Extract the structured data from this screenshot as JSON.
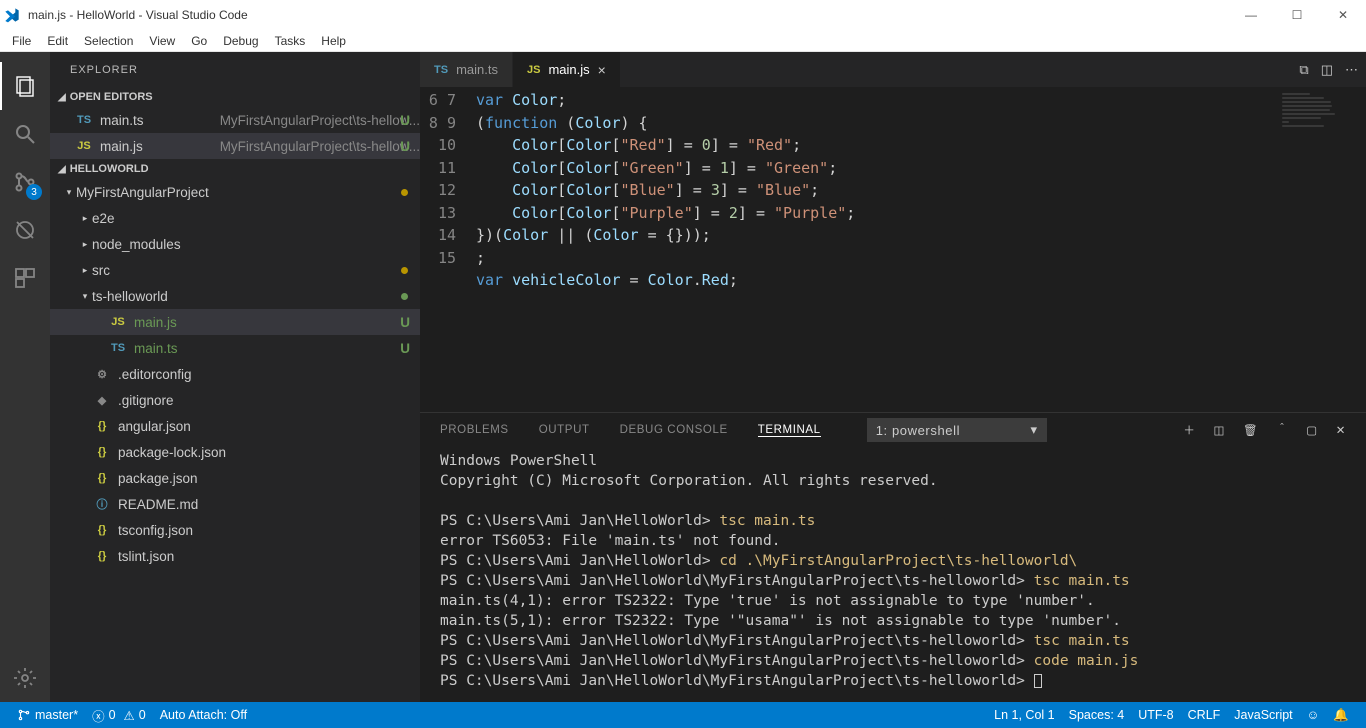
{
  "window": {
    "title": "main.js - HelloWorld - Visual Studio Code"
  },
  "menu": [
    "File",
    "Edit",
    "Selection",
    "View",
    "Go",
    "Debug",
    "Tasks",
    "Help"
  ],
  "activitybar_badge": "3",
  "sidebar": {
    "title": "EXPLORER",
    "open_editors_label": "OPEN EDITORS",
    "open_editors": [
      {
        "icon": "TS",
        "iconClass": "ts",
        "name": "main.ts",
        "meta": "MyFirstAngularProject\\ts-hellow...",
        "badge": "U"
      },
      {
        "icon": "JS",
        "iconClass": "js",
        "name": "main.js",
        "meta": "MyFirstAngularProject\\ts-hellow...",
        "badge": "U",
        "active": true
      }
    ],
    "repo_label": "HELLOWORLD",
    "tree": [
      {
        "indent": 0,
        "chev": "▾",
        "name": "MyFirstAngularProject",
        "dot": "#b89500"
      },
      {
        "indent": 1,
        "chev": "▸",
        "name": "e2e"
      },
      {
        "indent": 1,
        "chev": "▸",
        "name": "node_modules"
      },
      {
        "indent": 1,
        "chev": "▸",
        "name": "src",
        "dot": "#b89500"
      },
      {
        "indent": 1,
        "chev": "▾",
        "name": "ts-helloworld",
        "dot": "#6a9955"
      },
      {
        "indent": 2,
        "icon": "JS",
        "iconClass": "js",
        "name": "main.js",
        "badge": "U",
        "active": true,
        "color": "#6a9955"
      },
      {
        "indent": 2,
        "icon": "TS",
        "iconClass": "ts",
        "name": "main.ts",
        "badge": "U",
        "color": "#6a9955"
      },
      {
        "indent": 1,
        "icon": "⚙",
        "iconClass": "gear-i",
        "name": ".editorconfig"
      },
      {
        "indent": 1,
        "icon": "◆",
        "iconClass": "gear-i",
        "name": ".gitignore"
      },
      {
        "indent": 1,
        "icon": "{}",
        "iconClass": "json-i",
        "name": "angular.json"
      },
      {
        "indent": 1,
        "icon": "{}",
        "iconClass": "json-i",
        "name": "package-lock.json"
      },
      {
        "indent": 1,
        "icon": "{}",
        "iconClass": "json-i",
        "name": "package.json"
      },
      {
        "indent": 1,
        "icon": "ⓘ",
        "iconClass": "info-i",
        "name": "README.md"
      },
      {
        "indent": 1,
        "icon": "{}",
        "iconClass": "json-i",
        "name": "tsconfig.json"
      },
      {
        "indent": 1,
        "icon": "{}",
        "iconClass": "json-i",
        "name": "tslint.json"
      }
    ]
  },
  "tabs": [
    {
      "icon": "TS",
      "iconClass": "ts",
      "name": "main.ts"
    },
    {
      "icon": "JS",
      "iconClass": "js",
      "name": "main.js",
      "active": true,
      "close": true
    }
  ],
  "code_lines": [
    {
      "n": 6,
      "html": "<span class='k-blue'>var</span> <span class='k-lblue'>Color</span>;"
    },
    {
      "n": 7,
      "html": "(<span class='k-blue'>function</span> (<span class='k-lblue'>Color</span>) {"
    },
    {
      "n": 8,
      "html": "    <span class='k-lblue'>Color</span>[<span class='k-lblue'>Color</span>[<span class='k-str'>\"Red\"</span>] = <span class='k-num'>0</span>] = <span class='k-str'>\"Red\"</span>;"
    },
    {
      "n": 9,
      "html": "    <span class='k-lblue'>Color</span>[<span class='k-lblue'>Color</span>[<span class='k-str'>\"Green\"</span>] = <span class='k-num'>1</span>] = <span class='k-str'>\"Green\"</span>;"
    },
    {
      "n": 10,
      "html": "    <span class='k-lblue'>Color</span>[<span class='k-lblue'>Color</span>[<span class='k-str'>\"Blue\"</span>] = <span class='k-num'>3</span>] = <span class='k-str'>\"Blue\"</span>;"
    },
    {
      "n": 11,
      "html": "    <span class='k-lblue'>Color</span>[<span class='k-lblue'>Color</span>[<span class='k-str'>\"Purple\"</span>] = <span class='k-num'>2</span>] = <span class='k-str'>\"Purple\"</span>;"
    },
    {
      "n": 12,
      "html": "})(<span class='k-lblue'>Color</span> || (<span class='k-lblue'>Color</span> = {}));"
    },
    {
      "n": 13,
      "html": ";"
    },
    {
      "n": 14,
      "html": "<span class='k-blue'>var</span> <span class='k-lblue'>vehicleColor</span> = <span class='k-lblue'>Color</span>.<span class='k-lblue'>Red</span>;"
    },
    {
      "n": 15,
      "html": ""
    }
  ],
  "panel": {
    "tabs": [
      "PROBLEMS",
      "OUTPUT",
      "DEBUG CONSOLE",
      "TERMINAL"
    ],
    "active_tab": "TERMINAL",
    "select": "1: powershell"
  },
  "terminal_lines": [
    {
      "t": "Windows PowerShell"
    },
    {
      "t": "Copyright (C) Microsoft Corporation. All rights reserved."
    },
    {
      "t": ""
    },
    {
      "pre": "PS C:\\Users\\Ami Jan\\HelloWorld> ",
      "cmd": "tsc main.ts"
    },
    {
      "t": "error TS6053: File 'main.ts' not found."
    },
    {
      "pre": "PS C:\\Users\\Ami Jan\\HelloWorld> ",
      "cmd": "cd .\\MyFirstAngularProject\\ts-helloworld\\"
    },
    {
      "pre": "PS C:\\Users\\Ami Jan\\HelloWorld\\MyFirstAngularProject\\ts-helloworld> ",
      "cmd": "tsc main.ts"
    },
    {
      "t": "main.ts(4,1): error TS2322: Type 'true' is not assignable to type 'number'."
    },
    {
      "t": "main.ts(5,1): error TS2322: Type '\"usama\"' is not assignable to type 'number'."
    },
    {
      "pre": "PS C:\\Users\\Ami Jan\\HelloWorld\\MyFirstAngularProject\\ts-helloworld> ",
      "cmd": "tsc main.ts"
    },
    {
      "pre": "PS C:\\Users\\Ami Jan\\HelloWorld\\MyFirstAngularProject\\ts-helloworld> ",
      "cmd": "code main.js"
    },
    {
      "pre": "PS C:\\Users\\Ami Jan\\HelloWorld\\MyFirstAngularProject\\ts-helloworld> ",
      "cursor": true
    }
  ],
  "statusbar": {
    "branch": "master*",
    "errors": "0",
    "warnings": "0",
    "auto": "Auto Attach: Off",
    "ln": "Ln 1, Col 1",
    "spaces": "Spaces: 4",
    "enc": "UTF-8",
    "eol": "CRLF",
    "lang": "JavaScript"
  }
}
